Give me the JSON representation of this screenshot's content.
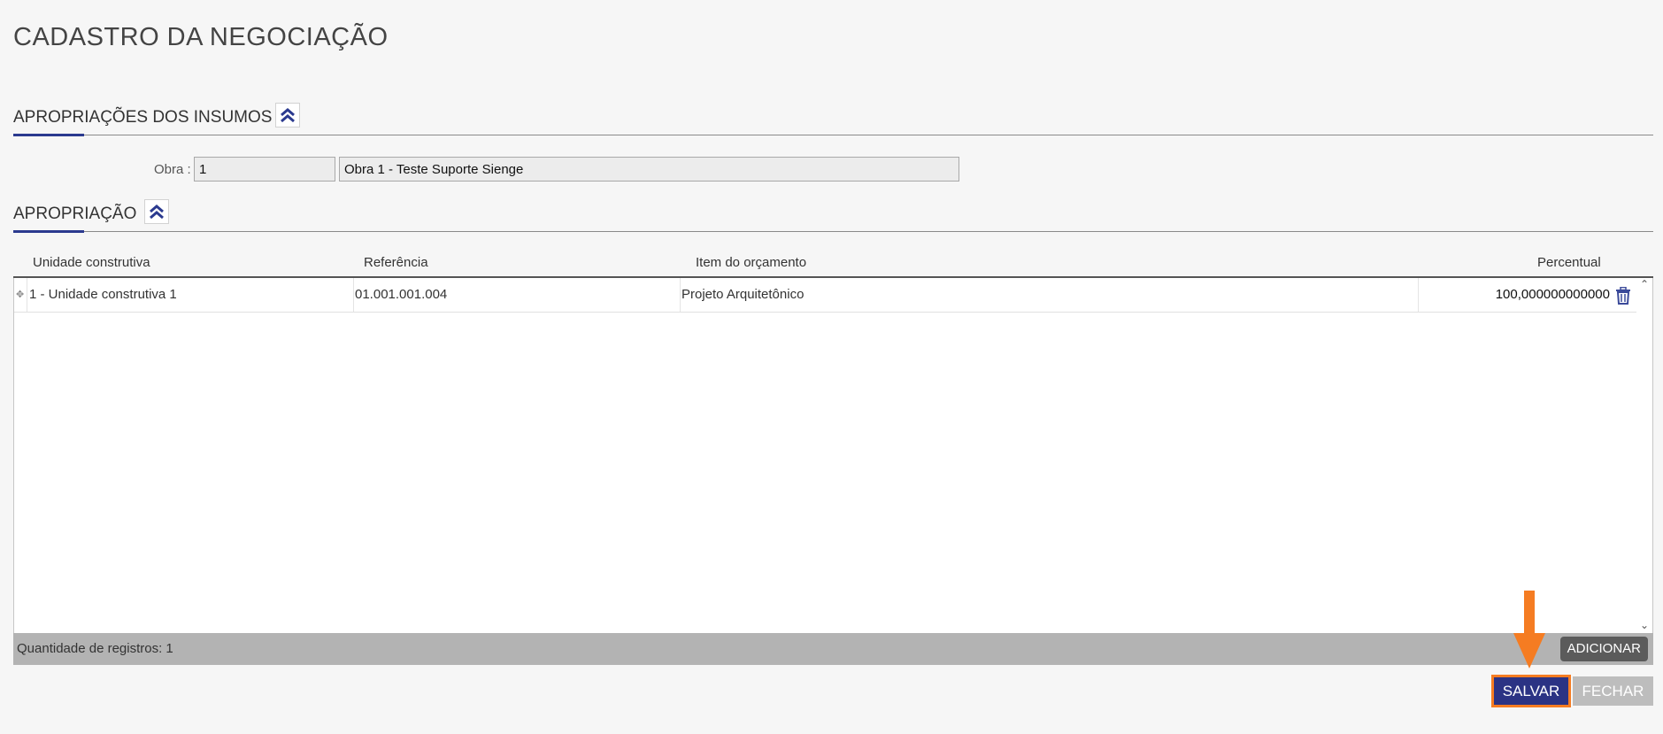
{
  "page": {
    "title": "CADASTRO DA NEGOCIAÇÃO"
  },
  "section_insumos": {
    "title": "APROPRIAÇÕES DOS INSUMOS",
    "collapse_icon": "double-chevron-up-icon"
  },
  "obra": {
    "label": "Obra :",
    "code": "1",
    "name": "Obra 1 - Teste Suporte Sienge"
  },
  "section_apropriacao": {
    "title": "APROPRIAÇÃO",
    "collapse_icon": "double-chevron-up-icon"
  },
  "grid": {
    "columns": [
      "Unidade construtiva",
      "Referência",
      "Item do orçamento",
      "Percentual"
    ],
    "rows": [
      {
        "unidade": "1 - Unidade construtiva 1",
        "referencia": "01.001.001.004",
        "item": "Projeto Arquitetônico",
        "percentual": "100,000000000000",
        "row_icon": "move-handle-icon",
        "delete_icon": "trash-icon"
      }
    ],
    "footer": {
      "count_text": "Quantidade de registros: 1",
      "add_label": "ADICIONAR"
    }
  },
  "actions": {
    "save_label": "SALVAR",
    "close_label": "FECHAR"
  },
  "colors": {
    "accent": "#2b3a8f",
    "save_bg": "#2b3384",
    "highlight": "#f57c22",
    "close_bg": "#bdbdbd"
  }
}
